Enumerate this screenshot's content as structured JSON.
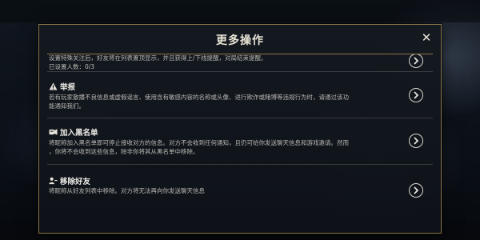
{
  "dialog": {
    "title": "更多操作",
    "close_glyph": "✕"
  },
  "rows": [
    {
      "title": "",
      "icon": "",
      "desc_lines": [
        "设置特殊关注后，好友将在列表置顶显示，并且获得上/下线提醒，对局结束提醒。",
        "已设置人数：0/3"
      ]
    },
    {
      "title": "举报",
      "icon": "warning-icon",
      "desc_lines": [
        "若有玩家散播不良信息或虚假谣言、使用含有敏感内容的名称或头像、进行欺诈或赌博等违规行为时，请通过该功",
        "能通知我们。"
      ]
    },
    {
      "title": "加入黑名单",
      "icon": "block-user-icon",
      "desc_lines": [
        "将昵称加入黑名单即可停止接收对方的信息。对方不会收到任何通知，且仍可给你发送聊天信息和游戏邀请。然而",
        "，你将不会收到这些信息，除非你将其从黑名单中移除。"
      ]
    },
    {
      "title": "移除好友",
      "icon": "remove-user-icon",
      "desc_lines": [
        "将昵称从好友列表中移除。对方将无法再向你发送聊天信息"
      ]
    }
  ],
  "colors": {
    "border_gold": "#8a7446",
    "title_text": "#e9e4d6",
    "desc_text": "#b9b8b2"
  }
}
